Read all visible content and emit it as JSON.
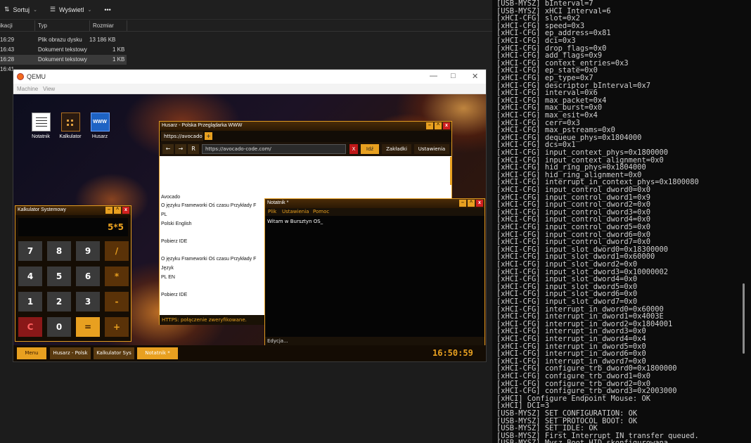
{
  "explorer": {
    "sort_label": "Sortuj",
    "view_label": "Wyświetl",
    "more_label": "•••",
    "columns": [
      "ikacji",
      "Typ",
      "Rozmiar"
    ],
    "rows": [
      {
        "time": "16:29",
        "type": "Plik obrazu dysku",
        "size": "13 186 KB"
      },
      {
        "time": "16:43",
        "type": "Dokument tekstowy",
        "size": "1 KB"
      },
      {
        "time": "16:28",
        "type": "Dokument tekstowy",
        "size": "1 KB"
      },
      {
        "time": "16:41",
        "type": "",
        "size": ""
      }
    ]
  },
  "qemu": {
    "title": "QEMU",
    "menu": [
      "Machine",
      "View"
    ],
    "win_controls": [
      "—",
      "□",
      "✕"
    ]
  },
  "desktop": {
    "icons": [
      {
        "label": "Notatnik"
      },
      {
        "label": "Kalkulator"
      },
      {
        "label": "Husarz",
        "glyph": "WWW"
      }
    ]
  },
  "browser": {
    "title": "Husarz - Polska Przeglądarka WWW",
    "tab_label": "https://avocado",
    "new_tab": "+",
    "nav": [
      "←",
      "→",
      "R"
    ],
    "url": "https://avocado-code.com/",
    "stop": "X",
    "go": "Idź",
    "bookmarks": "Zakładki",
    "settings": "Ustawienia",
    "page_lines": [
      "Avocado",
      "O języku  Frameworki  Oś czasu  Przykłady  F",
      "PL",
      "Polski  English",
      "Pobierz IDE",
      "O języku  Frameworki  Oś czasu  Przykłady  F",
      "Język",
      "PL  EN",
      "Pobierz IDE"
    ],
    "status": "HTTPS: połączenie zweryfikowane."
  },
  "notepad": {
    "title": "Notatnik *",
    "menu": [
      "Plik",
      "Ustawienia",
      "Pomoc"
    ],
    "content": "Witam w Bursztyn OS_",
    "status": "Edycja..."
  },
  "calculator": {
    "title": "Kalkulator Systemowy",
    "display": "5*5",
    "keys": [
      "7",
      "8",
      "9",
      "/",
      "4",
      "5",
      "6",
      "*",
      "1",
      "2",
      "3",
      "-",
      "C",
      "0",
      "=",
      "+"
    ]
  },
  "taskbar": {
    "items": [
      "Menu",
      "Husarz - Polsk",
      "Kalkulator Sys",
      "Notatnik *"
    ],
    "clock": "16:50:59"
  },
  "terminal": {
    "lines": [
      "[USB-MYSZ] bInterval=7",
      "[USB-MYSZ] xHCI Interval=6",
      "[xHCI-CFG] slot=0x2",
      "[xHCI-CFG] speed=0x3",
      "[xHCI-CFG] ep_address=0x81",
      "[xHCI-CFG] dci=0x3",
      "[xHCI-CFG] drop_flags=0x0",
      "[xHCI-CFG] add_flags=0x9",
      "[xHCI-CFG] context_entries=0x3",
      "[xHCI-CFG] ep_state=0x0",
      "[xHCI-CFG] ep_type=0x7",
      "[xHCI-CFG] descriptor_bInterval=0x7",
      "[xHCI-CFG] interval=0x6",
      "[xHCI-CFG] max_packet=0x4",
      "[xHCI-CFG] max_burst=0x0",
      "[xHCI-CFG] max_esit=0x4",
      "[xHCI-CFG] cerr=0x3",
      "[xHCI-CFG] max_pstreams=0x0",
      "[xHCI-CFG] dequeue_phys=0x1804000",
      "[xHCI-CFG] dcs=0x1",
      "[xHCI-CFG] input_context_phys=0x1800000",
      "[xHCI-CFG] input_context_alignment=0x0",
      "[xHCI-CFG] hid_ring_phys=0x1804000",
      "[xHCI-CFG] hid_ring_alignment=0x0",
      "[xHCI-CFG] interrupt_in_context_phys=0x1800080",
      "[xHCI-CFG] input_control_dword0=0x0",
      "[xHCI-CFG] input_control_dword1=0x9",
      "[xHCI-CFG] input_control_dword2=0x0",
      "[xHCI-CFG] input_control_dword3=0x0",
      "[xHCI-CFG] input_control_dword4=0x0",
      "[xHCI-CFG] input_control_dword5=0x0",
      "[xHCI-CFG] input_control_dword6=0x0",
      "[xHCI-CFG] input_control_dword7=0x0",
      "[xHCI-CFG] input_slot_dword0=0x18300000",
      "[xHCI-CFG] input_slot_dword1=0x60000",
      "[xHCI-CFG] input_slot_dword2=0x0",
      "[xHCI-CFG] input_slot_dword3=0x10000002",
      "[xHCI-CFG] input_slot_dword4=0x0",
      "[xHCI-CFG] input_slot_dword5=0x0",
      "[xHCI-CFG] input_slot_dword6=0x0",
      "[xHCI-CFG] input_slot_dword7=0x0",
      "[xHCI-CFG] interrupt_in_dword0=0x60000",
      "[xHCI-CFG] interrupt_in_dword1=0x4003E",
      "[xHCI-CFG] interrupt_in_dword2=0x1804001",
      "[xHCI-CFG] interrupt_in_dword3=0x0",
      "[xHCI-CFG] interrupt_in_dword4=0x4",
      "[xHCI-CFG] interrupt_in_dword5=0x0",
      "[xHCI-CFG] interrupt_in_dword6=0x0",
      "[xHCI-CFG] interrupt_in_dword7=0x0",
      "[xHCI-CFG] configure_trb_dword0=0x1800000",
      "[xHCI-CFG] configure_trb_dword1=0x0",
      "[xHCI-CFG] configure_trb_dword2=0x0",
      "[xHCI-CFG] configure_trb_dword3=0x2003000",
      "[xHCI] Configure Endpoint Mouse: OK",
      "[xHCI] DCI=3",
      "[USB-MYSZ] SET_CONFIGURATION: OK",
      "[USB-MYSZ] SET_PROTOCOL BOOT: OK",
      "[USB-MYSZ] SET_IDLE: OK",
      "[USB-MYSZ] First Interrupt IN transfer queued.",
      "[USB-MYSZ] Mysz Boot HID skonfigurowana."
    ]
  }
}
